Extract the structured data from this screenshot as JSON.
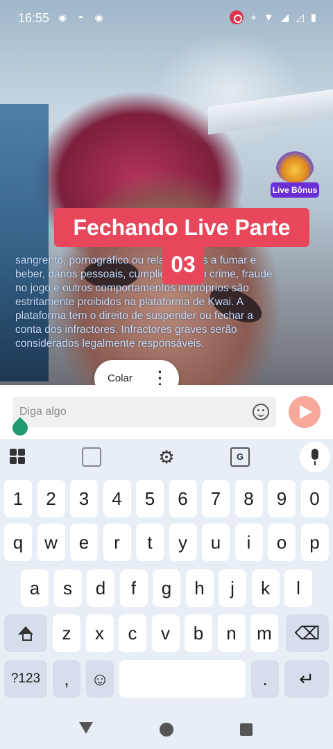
{
  "status_bar": {
    "time": "16:55",
    "left_icons": "◉ ◓ ◉",
    "right_icons": [
      "location-icon",
      "wifi-icon",
      "signal-icon",
      "signal-icon",
      "battery-icon"
    ]
  },
  "live": {
    "title_line1": "Fechando Live Parte",
    "title_line2": "03",
    "bonus_label": "Live Bônus",
    "warning_text": "sangrento, pornográfico ou relacionados a fumar e beber, danos pessoais, cumplicidade no crime, fraude no jogo e outros comportamentos impróprios são estritamente proibidos na plataforma de Kwai. A plataforma tem o direito de suspender ou fechar a conta dos infractores. Infractores graves serão considerados legalmente responsáveis."
  },
  "paste_popup": {
    "label": "Colar",
    "more": "⋮"
  },
  "comment_input": {
    "placeholder": "Diga algo"
  },
  "keyboard": {
    "row_numbers": [
      "1",
      "2",
      "3",
      "4",
      "5",
      "6",
      "7",
      "8",
      "9",
      "0"
    ],
    "row_top": [
      "q",
      "w",
      "e",
      "r",
      "t",
      "y",
      "u",
      "i",
      "o",
      "p"
    ],
    "row_middle": [
      "a",
      "s",
      "d",
      "f",
      "g",
      "h",
      "j",
      "k",
      "l"
    ],
    "row_bottom": [
      "z",
      "x",
      "c",
      "v",
      "b",
      "n",
      "m"
    ],
    "symbols_label": "?123",
    "comma": ",",
    "period": ".",
    "backspace": "⌫",
    "enter": "↵",
    "emoji": "☺",
    "translate": "G"
  },
  "colors": {
    "banner": "#e8475b",
    "send_button": "#f7a89a",
    "bonus_badge": "#6a2fd6",
    "key_bg": "#ffffff",
    "keyboard_bg": "#e8eef6"
  }
}
